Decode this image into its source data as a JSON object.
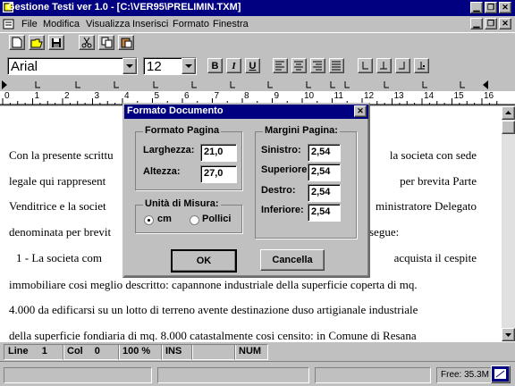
{
  "app": {
    "title": "Gestione Testi ver 1.0 - [C:\\VER95\\PRELIMIN.TXM]"
  },
  "menu": {
    "items": [
      "File",
      "Modifica",
      "Visualizza",
      "Inserisci",
      "Formato",
      "Finestra"
    ]
  },
  "format_toolbar": {
    "font": "Arial",
    "size": "12",
    "bold": "B",
    "italic": "I",
    "underline": "U"
  },
  "ruler": {
    "ticks": [
      "0",
      "1",
      "2",
      "3",
      "4",
      "5",
      "6",
      "7",
      "8",
      "9",
      "10",
      "11",
      "12",
      "13",
      "14",
      "15",
      "16"
    ]
  },
  "document": {
    "lines": [
      "Con la presente scrittu",
      "legale qui rappresent",
      "Venditrice e la societ",
      "denominata per brevit",
      "1 -  La societa com",
      "immobiliare cosi meglio descritto: capannone industriale della superficie coperta di mq.",
      "4.000 da edificarsi su un lotto di terreno avente destinazione duso artigianale industriale",
      "della superficie fondiaria di mq. 8.000  catastalmente cosi censito: in Comune di Resana"
    ],
    "lines_right": [
      "la societa  con sede",
      "per brevita Parte",
      "ministratore Delegato",
      "segue:",
      "acquista  il cespite"
    ]
  },
  "dialog": {
    "title": "Formato Documento",
    "formato_pagina": {
      "title": "Formato Pagina",
      "larghezza_label": "Larghezza:",
      "larghezza_value": "21,0",
      "altezza_label": "Altezza:",
      "altezza_value": "27,0"
    },
    "unita_misura": {
      "title": "Unità di Misura:",
      "cm_label": "cm",
      "pollici_label": "Pollici",
      "selected": "cm"
    },
    "margini_pagina": {
      "title": "Margini Pagina:",
      "sinistro_label": "Sinistro:",
      "sinistro_value": "2,54",
      "superiore_label": "Superiore:",
      "superiore_value": "2,54",
      "destro_label": "Destro:",
      "destro_value": "2,54",
      "inferiore_label": "Inferiore:",
      "inferiore_value": "2,54"
    },
    "ok_label": "OK",
    "cancel_label": "Cancella"
  },
  "status": {
    "line_label": "Line",
    "line_value": "1",
    "col_label": "Col",
    "col_value": "0",
    "zoom": "100 %",
    "ins": "INS",
    "num": "NUM",
    "free": "Free: 35.3M"
  }
}
